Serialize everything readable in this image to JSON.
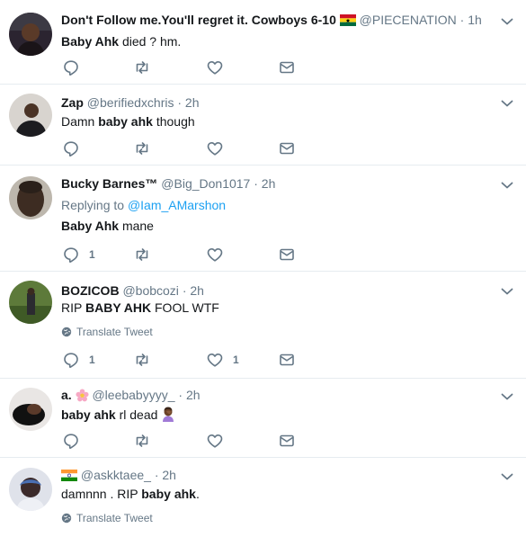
{
  "tweets": [
    {
      "name": "Don't Follow me.You'll regret it. Cowboys 6-10",
      "handle": "@PIECENATION",
      "time": "1h",
      "text_bold": "Baby Ahk",
      "text_rest": " died ? hm.",
      "flag_icon": "ghana-flag"
    },
    {
      "name": "Zap",
      "handle": "@berifiedxchris",
      "time": "2h",
      "text_pre": "Damn ",
      "text_bold": "baby ahk",
      "text_rest": " though"
    },
    {
      "name": "Bucky Barnes™",
      "handle": "@Big_Don1017",
      "time": "2h",
      "reply_prefix": "Replying to",
      "reply_to": "@Iam_AMarshon",
      "text_bold": "Baby Ahk",
      "text_rest": " mane",
      "reply_count": "1"
    },
    {
      "name": "BOZICOB",
      "handle": "@bobcozi",
      "time": "2h",
      "text_pre": "RIP ",
      "text_bold": "BABY AHK",
      "text_rest": " FOOL WTF",
      "translate": "Translate Tweet",
      "reply_count": "1",
      "like_count": "1"
    },
    {
      "name": "a.",
      "handle": "@leebabyyyy_",
      "time": "2h",
      "text_bold": "baby ahk",
      "text_rest": " rl dead",
      "name_icon": "flower-emoji",
      "text_icon": "person-facepalming-emoji"
    },
    {
      "handle": "@askktaee_",
      "time": "2h",
      "text_pre": "damnnn . RIP ",
      "text_bold": "baby ahk",
      "text_rest": ".",
      "translate": "Translate Tweet",
      "flag_icon": "india-flag"
    }
  ],
  "separator": "·",
  "colors": {
    "link": "#1da1f2",
    "muted": "#657786",
    "text": "#14171a",
    "divider": "#e6ecf0"
  }
}
